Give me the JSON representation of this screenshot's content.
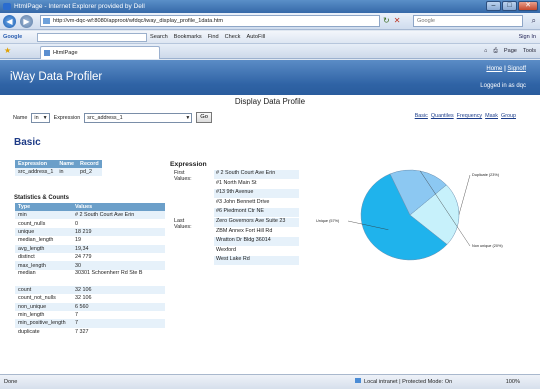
{
  "window": {
    "title": "HtmlPage - Internet Explorer provided by Dell"
  },
  "address_bar": {
    "url": "http://vm-dqc-wf:8080/approot/wfdqc/iway_display_profile_1data.htm",
    "search_placeholder": "Google"
  },
  "google_toolbar": {
    "label": "Google",
    "items": [
      "Search",
      "Bookmarks",
      "Find",
      "Check",
      "AutoFill"
    ],
    "sign_in": "Sign In"
  },
  "tabs": {
    "active": "HtmlPage"
  },
  "browser_tools": [
    "Page",
    "Tools"
  ],
  "app": {
    "brand": "iWay Data Profiler",
    "links": {
      "home": "Home",
      "separator": "|",
      "signoff": "Signoff"
    },
    "logged_in": "Logged in as dqc",
    "page_title": "Display Data Profile"
  },
  "controls": {
    "name_label": "Name",
    "name_value": "in",
    "expression_label": "Expression",
    "expression_value": "src_address_1",
    "go": "Go",
    "view_links": [
      "Basic",
      "Quantiles",
      "Frequency",
      "Mask",
      "Group"
    ]
  },
  "section": "Basic",
  "summary": {
    "headers": [
      "Expression",
      "Name",
      "Record"
    ],
    "row": [
      "src_address_1",
      "in",
      "pd_2"
    ]
  },
  "stats": {
    "title": "Statistics & Counts",
    "headers": [
      "Type",
      "Values"
    ],
    "rows": [
      [
        "min",
        "# 2 South Court Ave Erin"
      ],
      [
        "count_nulls",
        "0"
      ],
      [
        "unique",
        "18 219"
      ],
      [
        "median_length",
        "19"
      ],
      [
        "avg_length",
        "19,34"
      ],
      [
        "distinct",
        "24 779"
      ],
      [
        "max_length",
        "30"
      ],
      [
        "median",
        "30301 Schoenherr Rd Ste B"
      ],
      [
        "count",
        "32 106"
      ],
      [
        "count_not_nulls",
        "32 106"
      ],
      [
        "non_unique",
        "6 560"
      ],
      [
        "min_length",
        "7"
      ],
      [
        "min_positive_length",
        "7"
      ],
      [
        "duplicate",
        "7 327"
      ]
    ]
  },
  "expression": {
    "title": "Expression",
    "first_label": "First Values:",
    "first": [
      "# 2 South Court Ave Erin",
      "#1 North Main St",
      "#13 9th Avenue",
      "#3 John Bennett Drive",
      "#6 Piedmont Ctr NE"
    ],
    "last_label": "Last Values:",
    "last": [
      "Zero Governors Ave Suite 23",
      "ZBM Annex Fort Hill Rd",
      "Wratton Dr Bldg 36014",
      "Wexford",
      "West Lake Rd"
    ]
  },
  "chart_data": {
    "type": "pie",
    "labels": [
      "Unique (57%)",
      "Duplicate (23%)",
      "Non unique (20%)"
    ],
    "values": [
      57,
      23,
      20
    ],
    "colors": [
      "#1fb3ec",
      "#c7f1fb",
      "#8cc8f2"
    ]
  },
  "statusbar": {
    "left": "Done",
    "zone": "Local intranet | Protected Mode: On",
    "zoom": "100%"
  }
}
